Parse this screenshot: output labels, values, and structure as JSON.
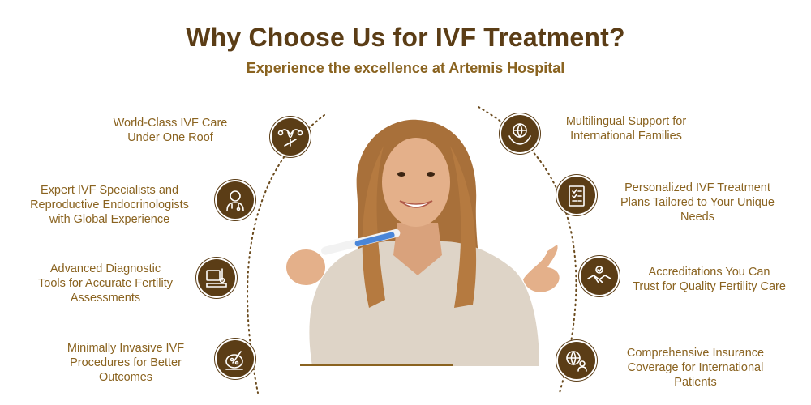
{
  "header": {
    "title": "Why Choose Us for IVF Treatment?",
    "subtitle": "Experience the excellence at Artemis Hospital"
  },
  "features_left": [
    {
      "text": "World-Class IVF Care\nUnder One Roof",
      "icon": "uterus-icon"
    },
    {
      "text": "Expert IVF Specialists and\nReproductive Endocrinologists\nwith Global Experience",
      "icon": "doctor-icon"
    },
    {
      "text": "Advanced Diagnostic\nTools for Accurate Fertility\nAssessments",
      "icon": "diagnostic-machine-icon"
    },
    {
      "text": "Minimally Invasive IVF\nProcedures for Better\nOutcomes",
      "icon": "microscope-dish-icon"
    }
  ],
  "features_right": [
    {
      "text": "Multilingual Support for\nInternational Families",
      "icon": "globe-hands-icon"
    },
    {
      "text": "Personalized IVF Treatment\nPlans Tailored to Your Unique\nNeeds",
      "icon": "checklist-icon"
    },
    {
      "text": "Accreditations You Can\nTrust for Quality Fertility Care",
      "icon": "handshake-icon"
    },
    {
      "text": "Comprehensive Insurance\nCoverage for International\nPatients",
      "icon": "globe-person-icon"
    }
  ],
  "colors": {
    "brown": "#5b3d16",
    "gold": "#8a6320"
  }
}
